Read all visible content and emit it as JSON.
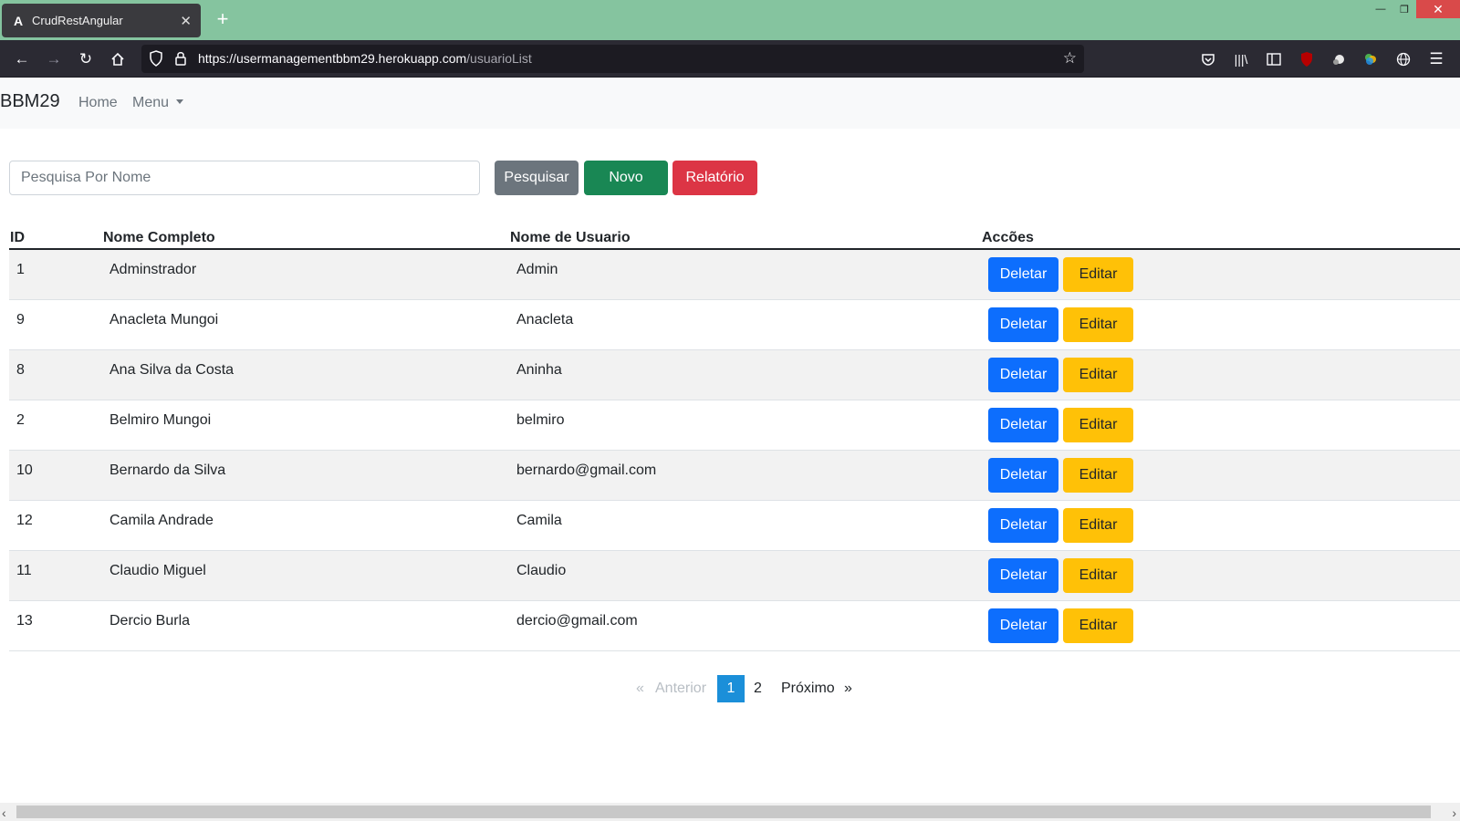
{
  "browser": {
    "tab_title": "CrudRestAngular",
    "tab_favicon": "A",
    "url_host": "https://usermanagementbbm29.herokuapp.com",
    "url_path": "/usuarioList"
  },
  "nav": {
    "brand": "BBM29",
    "home": "Home",
    "menu": "Menu"
  },
  "search": {
    "placeholder": "Pesquisa Por Nome",
    "btn_search": "Pesquisar",
    "btn_new": "Novo",
    "btn_report": "Relatório"
  },
  "table": {
    "headers": [
      "ID",
      "Nome Completo",
      "Nome de Usuario",
      "Accões"
    ],
    "delete_label": "Deletar",
    "edit_label": "Editar",
    "rows": [
      {
        "id": "1",
        "name": "Adminstrador",
        "user": "Admin"
      },
      {
        "id": "9",
        "name": "Anacleta Mungoi",
        "user": "Anacleta"
      },
      {
        "id": "8",
        "name": "Ana Silva da Costa",
        "user": "Aninha"
      },
      {
        "id": "2",
        "name": "Belmiro Mungoi",
        "user": "belmiro"
      },
      {
        "id": "10",
        "name": "Bernardo da Silva",
        "user": "bernardo@gmail.com"
      },
      {
        "id": "12",
        "name": "Camila Andrade",
        "user": "Camila"
      },
      {
        "id": "11",
        "name": "Claudio Miguel",
        "user": "Claudio"
      },
      {
        "id": "13",
        "name": "Dercio Burla",
        "user": "dercio@gmail.com"
      }
    ]
  },
  "pagination": {
    "prev_symbol": "«",
    "prev": "Anterior",
    "pages": [
      "1",
      "2"
    ],
    "current": "1",
    "next": "Próximo",
    "next_symbol": "»"
  },
  "colors": {
    "tabbar": "#85c49f",
    "primary": "#0d6efd",
    "warning": "#ffc107",
    "success": "#198754",
    "danger": "#dc3545",
    "secondary": "#6c757d"
  }
}
